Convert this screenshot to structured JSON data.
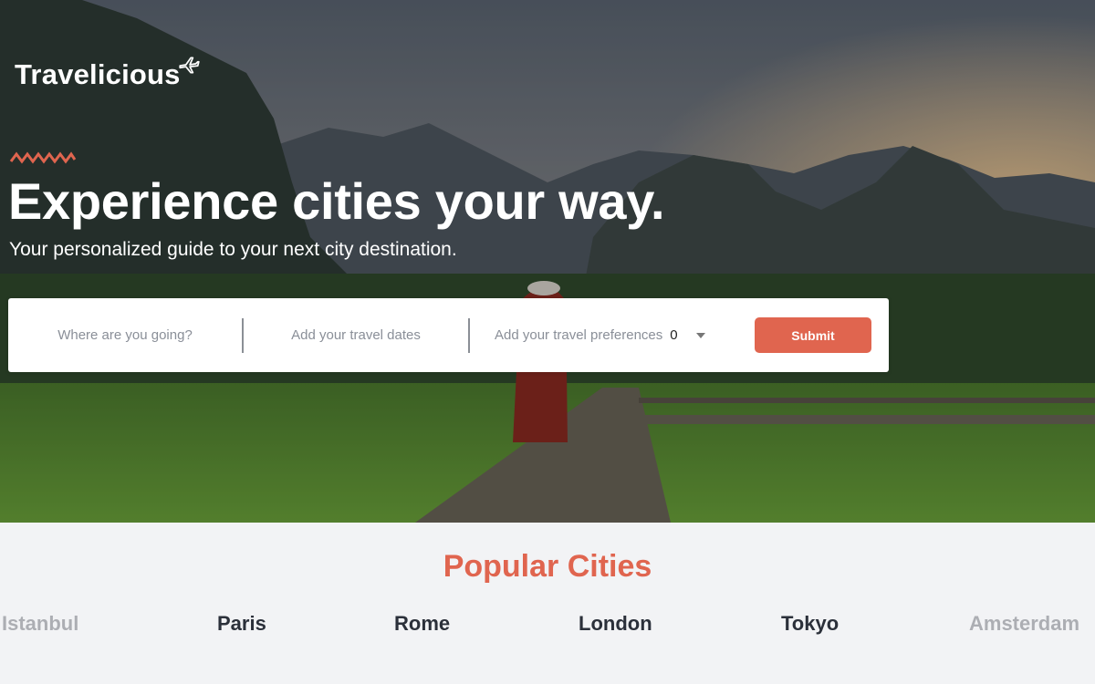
{
  "brand": {
    "name": "Travelicious",
    "accent": "#e0654f"
  },
  "hero": {
    "headline": "Experience cities your way.",
    "subheadline": "Your personalized guide to your next city destination."
  },
  "search": {
    "destination_placeholder": "Where are you going?",
    "dates_placeholder": "Add your travel dates",
    "preferences_placeholder": "Add your travel preferences",
    "preferences_count": "0",
    "submit_label": "Submit"
  },
  "popular": {
    "title": "Popular Cities",
    "cities": [
      "Istanbul",
      "Paris",
      "Rome",
      "London",
      "Tokyo",
      "Amsterdam"
    ]
  },
  "icons": {
    "logo": "airplane-icon",
    "decor": "squiggle-icon",
    "dropdown": "chevron-down-icon"
  }
}
